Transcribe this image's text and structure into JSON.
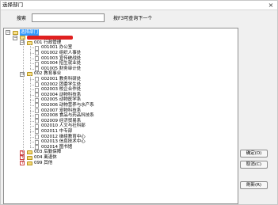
{
  "window": {
    "title": "选择部门",
    "close_glyph": "×"
  },
  "search": {
    "label": "搜索",
    "value": "",
    "placeholder": "",
    "hint": "按F3可查询下一个"
  },
  "tree": {
    "root_label": "选择部门",
    "org_name": "",
    "groups": [
      {
        "code": "001",
        "name": "行政管理",
        "expanded": true,
        "children": [
          {
            "code": "001001",
            "name": "办公室"
          },
          {
            "code": "001002",
            "name": "组织人事处"
          },
          {
            "code": "001003",
            "name": "宣传统战处"
          },
          {
            "code": "001004",
            "name": "招生就业处"
          },
          {
            "code": "001005",
            "name": "财务审计处"
          }
        ]
      },
      {
        "code": "002",
        "name": "教育事业",
        "expanded": true,
        "children": [
          {
            "code": "002001",
            "name": "教务科研处"
          },
          {
            "code": "002002",
            "name": "团委学生处"
          },
          {
            "code": "002003",
            "name": "校企合作处"
          },
          {
            "code": "002004",
            "name": "动物科技系"
          },
          {
            "code": "002005",
            "name": "动物医学系"
          },
          {
            "code": "002006",
            "name": "动物营养与水产系"
          },
          {
            "code": "002007",
            "name": "宠物科技系"
          },
          {
            "code": "002008",
            "name": "食品与药品科技系"
          },
          {
            "code": "002009",
            "name": "经济贸易系"
          },
          {
            "code": "002010",
            "name": "人文与社科部"
          },
          {
            "code": "002011",
            "name": "中专部"
          },
          {
            "code": "002012",
            "name": "继续教育中心"
          },
          {
            "code": "002013",
            "name": "信息技术中心"
          },
          {
            "code": "002014",
            "name": "图书馆"
          }
        ]
      },
      {
        "code": "003",
        "name": "后勤保障",
        "expanded": false
      },
      {
        "code": "004",
        "name": "离退休",
        "expanded": false
      },
      {
        "code": "099",
        "name": "其他",
        "expanded": false
      }
    ]
  },
  "buttons": {
    "ok": "确定(O)",
    "cancel": "取消(C)",
    "refresh": "刷新(R)"
  }
}
